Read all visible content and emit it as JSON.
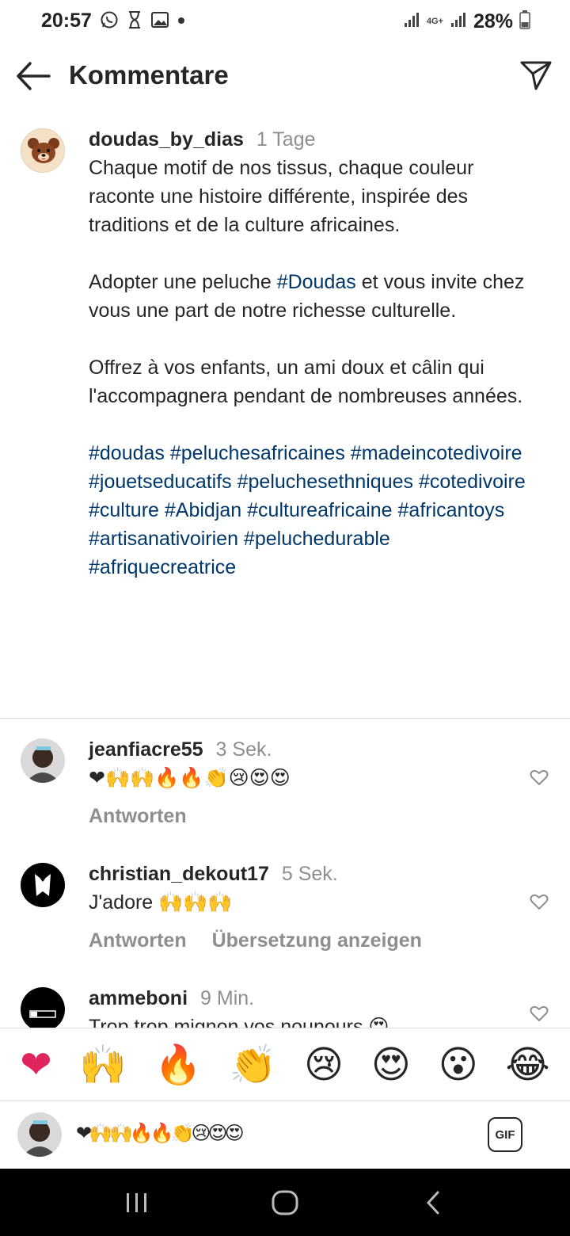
{
  "status_bar": {
    "time": "20:57",
    "battery": "28%",
    "network": "4G+"
  },
  "header": {
    "title": "Kommentare"
  },
  "caption": {
    "username": "doudas_by_dias",
    "time": "1 Tage",
    "para1": "Chaque motif de nos tissus, chaque couleur raconte une histoire différente, inspirée des traditions et de la culture africaines.",
    "para2_before": "Adopter une peluche ",
    "para2_tag": "#Doudas",
    "para2_after": " et vous invite chez vous une part de notre richesse culturelle.",
    "para3": "Offrez à vos enfants, un ami doux et câlin qui l'accompagnera pendant de nombreuses années.",
    "hashtags": "#doudas #peluchesafricaines #madeincotedivoire #jouetseducatifs #peluchesethniques #cotedivoire #culture #Abidjan #cultureafricaine #africantoys #artisanativoirien #peluchedurable #afriquecreatrice"
  },
  "comments": [
    {
      "username": "jeanfiacre55",
      "time": "3 Sek.",
      "text": "❤🙌🙌🔥🔥👏😢😍😍",
      "reply": "Antworten",
      "translate": ""
    },
    {
      "username": "christian_dekout17",
      "time": "5 Sek.",
      "text": "J'adore 🙌🙌🙌",
      "reply": "Antworten",
      "translate": "Übersetzung anzeigen"
    },
    {
      "username": "ammeboni",
      "time": "9 Min.",
      "text": "Trop trop mignon vos nounours 😍",
      "reply": "",
      "translate": ""
    }
  ],
  "emoji_bar": [
    "❤",
    "🙌",
    "🔥",
    "👏",
    "😢",
    "😍",
    "😮",
    "😂"
  ],
  "input": {
    "value": "❤🙌🙌🔥🔥👏😢😍😍",
    "gif_label": "GIF"
  },
  "colors": {
    "hashtag": "#00376b",
    "meta": "#8e8e8e",
    "divider": "#dbdbdb",
    "text": "#262626"
  }
}
